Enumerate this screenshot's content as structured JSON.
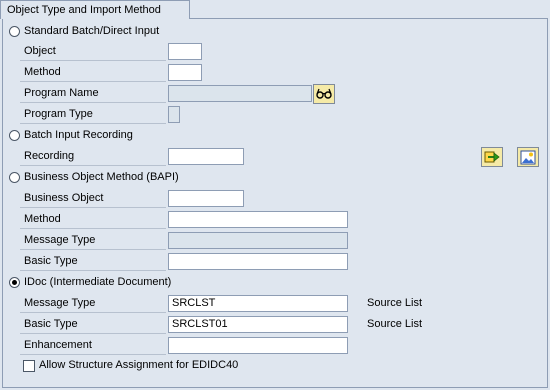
{
  "group": {
    "title": "Object Type and Import Method"
  },
  "standard": {
    "radio_label": "Standard Batch/Direct Input",
    "object_label": "Object",
    "method_label": "Method",
    "program_name_label": "Program Name",
    "program_type_label": "Program Type",
    "object_value": "",
    "method_value": "",
    "program_name_value": "",
    "program_type_value": ""
  },
  "recording": {
    "radio_label": "Batch Input Recording",
    "recording_label": "Recording",
    "recording_value": ""
  },
  "bapi": {
    "radio_label": "Business Object Method  (BAPI)",
    "business_object_label": "Business Object",
    "method_label": "Method",
    "message_type_label": "Message Type",
    "basic_type_label": "Basic Type",
    "business_object_value": "",
    "method_value": "",
    "message_type_value": "",
    "basic_type_value": ""
  },
  "idoc": {
    "radio_label": "IDoc (Intermediate Document)",
    "message_type_label": "Message Type",
    "message_type_value": "SRCLST",
    "message_type_desc": "Source List",
    "basic_type_label": "Basic Type",
    "basic_type_value": "SRCLST01",
    "basic_type_desc": "Source List",
    "enhancement_label": "Enhancement",
    "enhancement_value": ""
  },
  "allow_structure": {
    "label": "Allow Structure Assignment for EDIDC40",
    "checked": false
  },
  "selected_method": "idoc",
  "icons": {
    "program_name_button": "display-glasses-icon",
    "recording_enter_button": "enter-arrow-icon",
    "recording_overview_button": "overview-icon"
  }
}
